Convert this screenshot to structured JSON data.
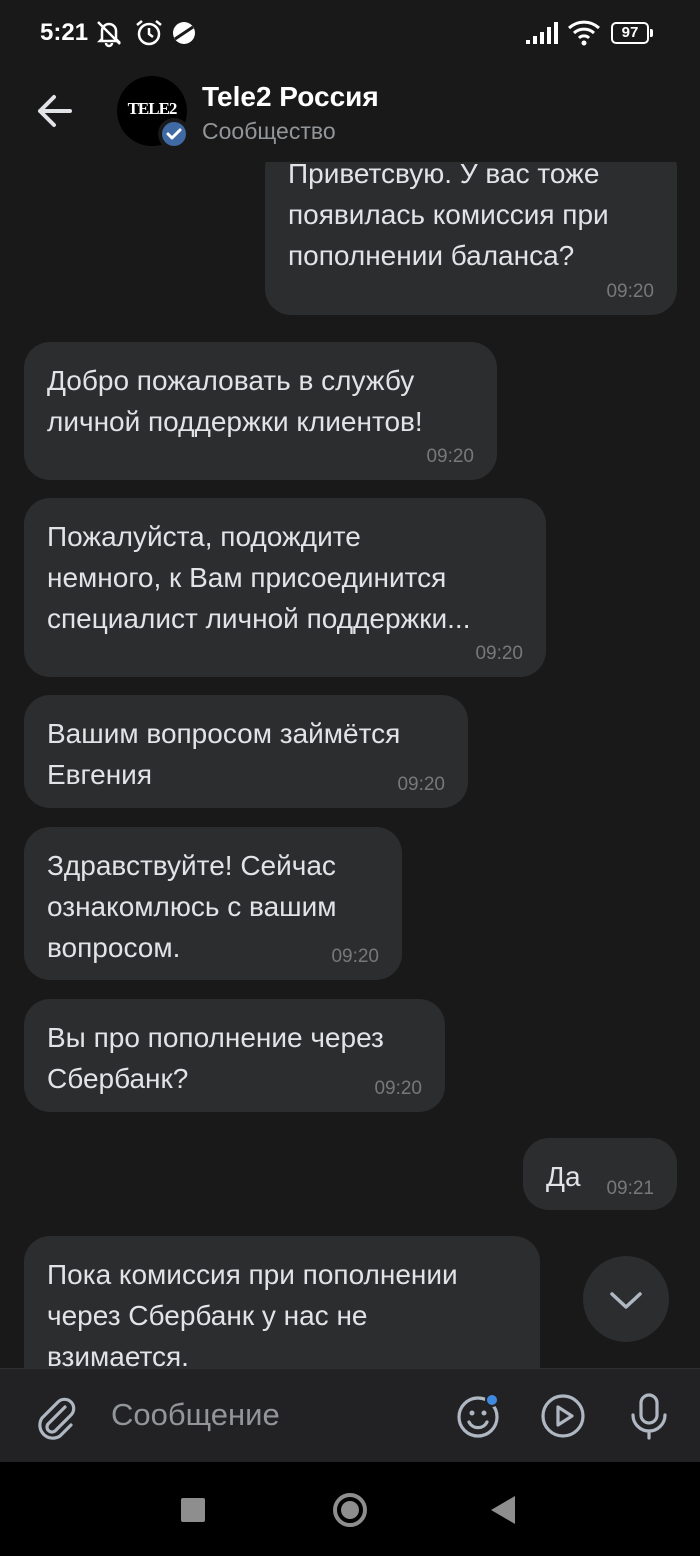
{
  "status_bar": {
    "time": "5:21",
    "battery": "97",
    "icons": [
      "mute-notifications-icon",
      "alarm-icon",
      "data-saver-icon",
      "signal-icon",
      "wifi-icon",
      "battery-icon"
    ]
  },
  "header": {
    "title": "Tele2 Россия",
    "subtitle": "Сообщество",
    "avatar_logo": "TELE2"
  },
  "messages": [
    {
      "side": "out",
      "text": "Приветсвую. У вас тоже\nпоявилась комиссия при\nпополнении баланса?",
      "time": "09:20"
    },
    {
      "side": "in",
      "text": "Добро пожаловать в службу\nличной поддержки клиентов!",
      "time": "09:20"
    },
    {
      "side": "in",
      "text": "Пожалуйста, подождите\nнемного, к Вам присоединится\nспециалист личной поддержки...",
      "time": "09:20"
    },
    {
      "side": "in",
      "text": "Вашим вопросом займётся\nЕвгения",
      "time": "09:20"
    },
    {
      "side": "in",
      "text": "Здравствуйте! Сейчас\nознакомлюсь с вашим\nвопросом.",
      "time": "09:20"
    },
    {
      "side": "in",
      "text": "Вы про пополнение через\nСбербанк?",
      "time": "09:20"
    },
    {
      "side": "out",
      "text": "Да",
      "time": "09:21"
    },
    {
      "side": "in",
      "text": "Пока комиссия при пополнении\nчерез Сбербанк у нас не\nвзимается.",
      "time": ""
    }
  ],
  "composer": {
    "placeholder": "Сообщение",
    "icons": [
      "attach-icon",
      "emoji-icon",
      "video-message-icon",
      "microphone-icon"
    ]
  },
  "colors": {
    "background": "#19191a",
    "bubble": "#2c2d2e",
    "accent": "#3f8ae0"
  }
}
